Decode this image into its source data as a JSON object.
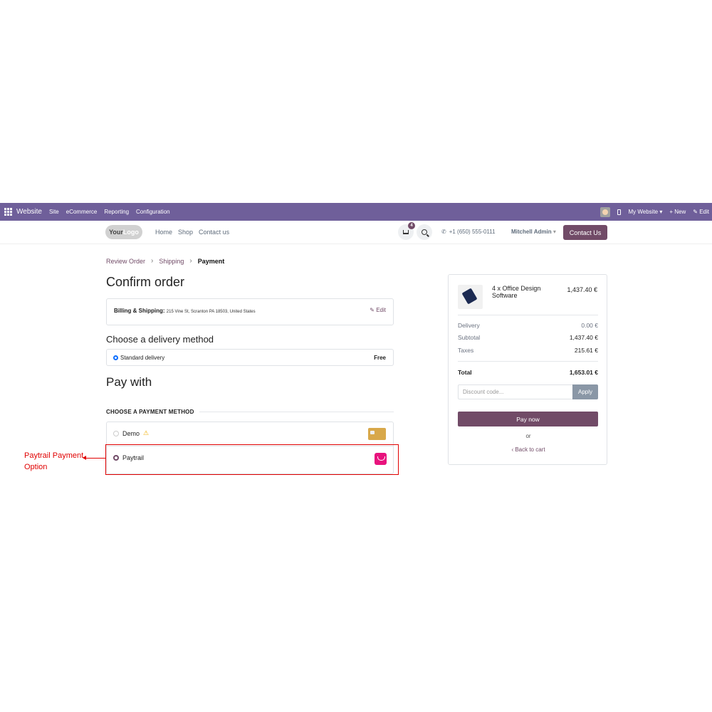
{
  "admin_bar": {
    "brand": "Website",
    "menu": [
      "Site",
      "eCommerce",
      "Reporting",
      "Configuration"
    ],
    "website_selector": "My Website ▾",
    "new_label": "+ New",
    "edit_label": "✎ Edit",
    "color": "#6f5f9a"
  },
  "header": {
    "logo_text_a": "Your",
    "logo_text_b": "Logo",
    "nav": [
      "Home",
      "Shop",
      "Contact us"
    ],
    "cart_count": "4",
    "phone": "+1 (650) 555-0111",
    "user": "Mitchell Admin",
    "contact_button": "Contact Us"
  },
  "breadcrumb": {
    "step1": "Review Order",
    "step2": "Shipping",
    "step3": "Payment"
  },
  "checkout": {
    "title": "Confirm order",
    "billing_label": "Billing & Shipping:",
    "billing_address": "215 Vine St, Scranton PA 18503, United States",
    "edit": "✎ Edit",
    "delivery_title": "Choose a delivery method",
    "delivery_option": "Standard delivery",
    "delivery_price": "Free",
    "pay_title": "Pay with",
    "choose_method": "CHOOSE A PAYMENT METHOD",
    "methods": [
      {
        "name": "Demo",
        "selected": false
      },
      {
        "name": "Paytrail",
        "selected": true
      }
    ]
  },
  "annotation": {
    "line1": "Paytrail Payment",
    "line2": "Option"
  },
  "summary": {
    "product_name": "4 x Office Design Software",
    "product_price": "1,437.40 €",
    "delivery_label": "Delivery",
    "delivery_value": "0.00 €",
    "subtotal_label": "Subtotal",
    "subtotal_value": "1,437.40 €",
    "taxes_label": "Taxes",
    "taxes_value": "215.61 €",
    "total_label": "Total",
    "total_value": "1,653.01 €",
    "discount_placeholder": "Discount code...",
    "apply": "Apply",
    "pay_now": "Pay now",
    "or": "or",
    "back": "‹  Back to cart"
  },
  "colors": {
    "brand": "#714B67",
    "highlight": "#e00000"
  }
}
